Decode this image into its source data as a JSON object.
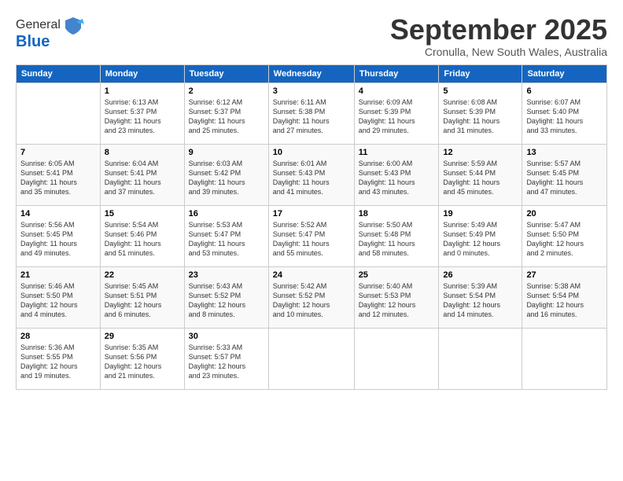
{
  "logo": {
    "general": "General",
    "blue": "Blue"
  },
  "title": "September 2025",
  "subtitle": "Cronulla, New South Wales, Australia",
  "headers": [
    "Sunday",
    "Monday",
    "Tuesday",
    "Wednesday",
    "Thursday",
    "Friday",
    "Saturday"
  ],
  "weeks": [
    [
      {
        "day": "",
        "content": ""
      },
      {
        "day": "1",
        "content": "Sunrise: 6:13 AM\nSunset: 5:37 PM\nDaylight: 11 hours\nand 23 minutes."
      },
      {
        "day": "2",
        "content": "Sunrise: 6:12 AM\nSunset: 5:37 PM\nDaylight: 11 hours\nand 25 minutes."
      },
      {
        "day": "3",
        "content": "Sunrise: 6:11 AM\nSunset: 5:38 PM\nDaylight: 11 hours\nand 27 minutes."
      },
      {
        "day": "4",
        "content": "Sunrise: 6:09 AM\nSunset: 5:39 PM\nDaylight: 11 hours\nand 29 minutes."
      },
      {
        "day": "5",
        "content": "Sunrise: 6:08 AM\nSunset: 5:39 PM\nDaylight: 11 hours\nand 31 minutes."
      },
      {
        "day": "6",
        "content": "Sunrise: 6:07 AM\nSunset: 5:40 PM\nDaylight: 11 hours\nand 33 minutes."
      }
    ],
    [
      {
        "day": "7",
        "content": "Sunrise: 6:05 AM\nSunset: 5:41 PM\nDaylight: 11 hours\nand 35 minutes."
      },
      {
        "day": "8",
        "content": "Sunrise: 6:04 AM\nSunset: 5:41 PM\nDaylight: 11 hours\nand 37 minutes."
      },
      {
        "day": "9",
        "content": "Sunrise: 6:03 AM\nSunset: 5:42 PM\nDaylight: 11 hours\nand 39 minutes."
      },
      {
        "day": "10",
        "content": "Sunrise: 6:01 AM\nSunset: 5:43 PM\nDaylight: 11 hours\nand 41 minutes."
      },
      {
        "day": "11",
        "content": "Sunrise: 6:00 AM\nSunset: 5:43 PM\nDaylight: 11 hours\nand 43 minutes."
      },
      {
        "day": "12",
        "content": "Sunrise: 5:59 AM\nSunset: 5:44 PM\nDaylight: 11 hours\nand 45 minutes."
      },
      {
        "day": "13",
        "content": "Sunrise: 5:57 AM\nSunset: 5:45 PM\nDaylight: 11 hours\nand 47 minutes."
      }
    ],
    [
      {
        "day": "14",
        "content": "Sunrise: 5:56 AM\nSunset: 5:45 PM\nDaylight: 11 hours\nand 49 minutes."
      },
      {
        "day": "15",
        "content": "Sunrise: 5:54 AM\nSunset: 5:46 PM\nDaylight: 11 hours\nand 51 minutes."
      },
      {
        "day": "16",
        "content": "Sunrise: 5:53 AM\nSunset: 5:47 PM\nDaylight: 11 hours\nand 53 minutes."
      },
      {
        "day": "17",
        "content": "Sunrise: 5:52 AM\nSunset: 5:47 PM\nDaylight: 11 hours\nand 55 minutes."
      },
      {
        "day": "18",
        "content": "Sunrise: 5:50 AM\nSunset: 5:48 PM\nDaylight: 11 hours\nand 58 minutes."
      },
      {
        "day": "19",
        "content": "Sunrise: 5:49 AM\nSunset: 5:49 PM\nDaylight: 12 hours\nand 0 minutes."
      },
      {
        "day": "20",
        "content": "Sunrise: 5:47 AM\nSunset: 5:50 PM\nDaylight: 12 hours\nand 2 minutes."
      }
    ],
    [
      {
        "day": "21",
        "content": "Sunrise: 5:46 AM\nSunset: 5:50 PM\nDaylight: 12 hours\nand 4 minutes."
      },
      {
        "day": "22",
        "content": "Sunrise: 5:45 AM\nSunset: 5:51 PM\nDaylight: 12 hours\nand 6 minutes."
      },
      {
        "day": "23",
        "content": "Sunrise: 5:43 AM\nSunset: 5:52 PM\nDaylight: 12 hours\nand 8 minutes."
      },
      {
        "day": "24",
        "content": "Sunrise: 5:42 AM\nSunset: 5:52 PM\nDaylight: 12 hours\nand 10 minutes."
      },
      {
        "day": "25",
        "content": "Sunrise: 5:40 AM\nSunset: 5:53 PM\nDaylight: 12 hours\nand 12 minutes."
      },
      {
        "day": "26",
        "content": "Sunrise: 5:39 AM\nSunset: 5:54 PM\nDaylight: 12 hours\nand 14 minutes."
      },
      {
        "day": "27",
        "content": "Sunrise: 5:38 AM\nSunset: 5:54 PM\nDaylight: 12 hours\nand 16 minutes."
      }
    ],
    [
      {
        "day": "28",
        "content": "Sunrise: 5:36 AM\nSunset: 5:55 PM\nDaylight: 12 hours\nand 19 minutes."
      },
      {
        "day": "29",
        "content": "Sunrise: 5:35 AM\nSunset: 5:56 PM\nDaylight: 12 hours\nand 21 minutes."
      },
      {
        "day": "30",
        "content": "Sunrise: 5:33 AM\nSunset: 5:57 PM\nDaylight: 12 hours\nand 23 minutes."
      },
      {
        "day": "",
        "content": ""
      },
      {
        "day": "",
        "content": ""
      },
      {
        "day": "",
        "content": ""
      },
      {
        "day": "",
        "content": ""
      }
    ]
  ]
}
